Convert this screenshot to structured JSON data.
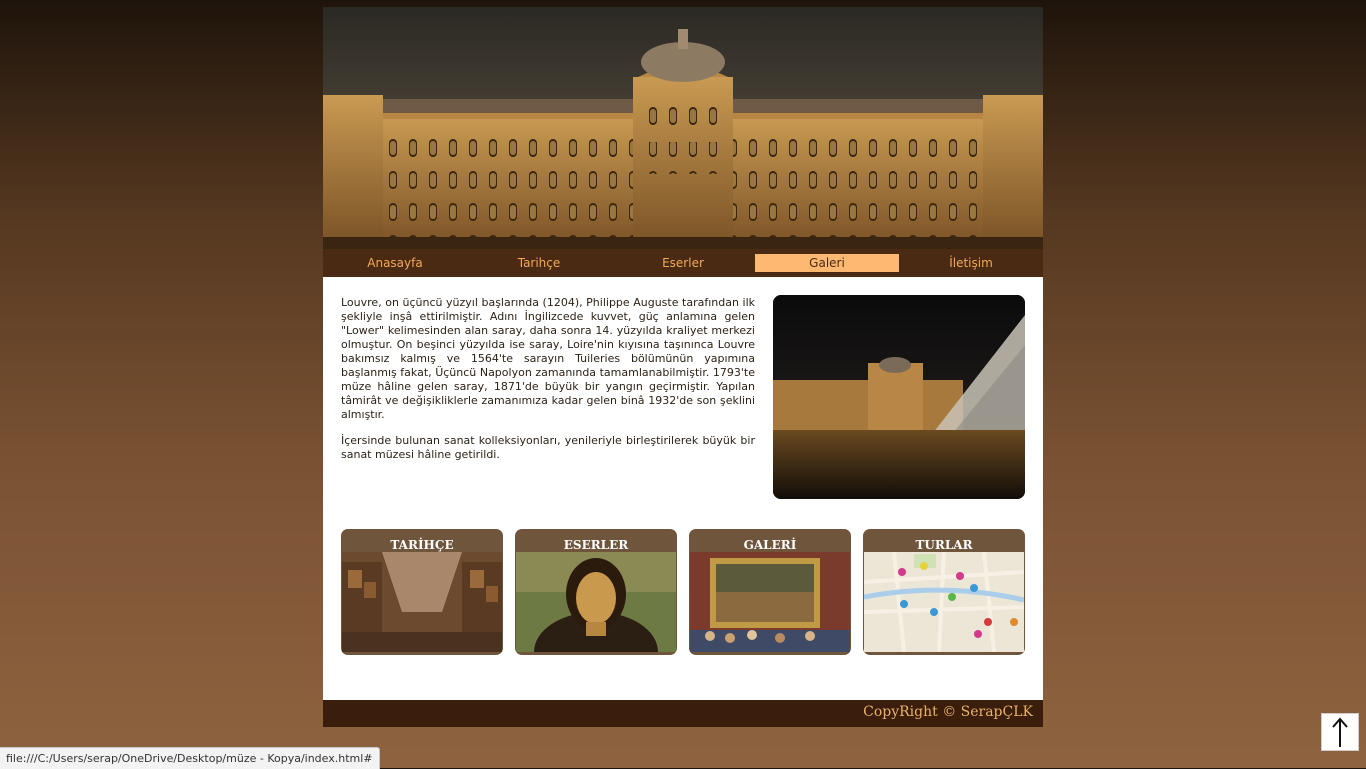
{
  "nav": {
    "items": [
      {
        "label": "Anasayfa"
      },
      {
        "label": "Tarihçe"
      },
      {
        "label": "Eserler"
      },
      {
        "label": "Galeri"
      },
      {
        "label": "İletişim"
      }
    ],
    "active_index": 3
  },
  "intro": {
    "paragraphs": [
      "Louvre, on üçüncü yüzyıl başlarında (1204), Philippe Auguste tarafından ilk şekliyle inşâ ettirilmiştir. Adını İngilizcede kuvvet, güç anlamına gelen \"Lower\" kelimesinden alan saray, daha sonra 14. yüzyılda kraliyet merkezi olmuştur. On beşinci yüzyılda ise saray, Loire'nin kıyısına taşınınca Louvre bakımsız kalmış ve 1564'te sarayın Tuileries bölümünün yapımına başlanmış fakat, Üçüncü Napolyon zamanında tamamlanabilmiştir. 1793'te müze hâline gelen saray, 1871'de büyük bir yangın geçirmiştir. Yapılan tâmirât ve değişikliklerle zamanımıza kadar gelen binâ 1932'de son şeklini almıştır.",
      "İçersinde bulunan sanat kolleksiyonları, yenileriyle birleştirilerek büyük bir sanat müzesi hâline getirildi."
    ]
  },
  "cards": [
    {
      "title": "TARİHÇE"
    },
    {
      "title": "ESERLER"
    },
    {
      "title": "GALERİ"
    },
    {
      "title": "TURLAR"
    }
  ],
  "footer": {
    "copyright": "CopyRight © SerapÇLK"
  },
  "statusbar": {
    "url": "file:///C:/Users/serap/OneDrive/Desktop/müze - Kopya/index.html#"
  },
  "icons": {
    "back_to_top": "arrow-up-icon"
  },
  "colors": {
    "nav_background": "#4a2a12",
    "nav_text": "#f2a95a",
    "nav_active_background": "#fdb872",
    "card_background": "#70553d",
    "footer_background": "#3a1d0b",
    "footer_text": "#eab26a"
  }
}
